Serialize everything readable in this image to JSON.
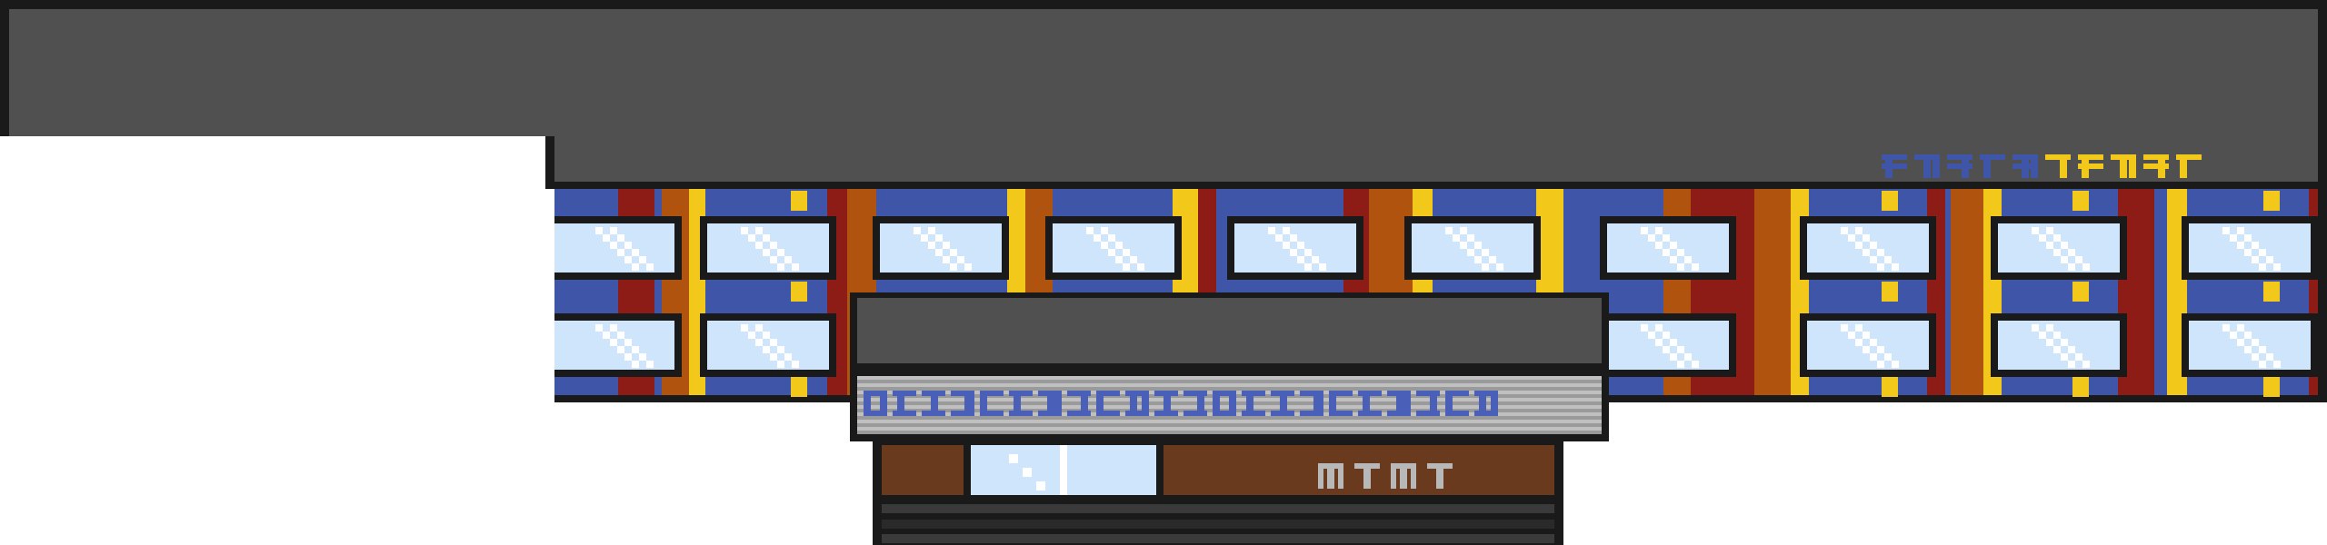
{
  "scene": {
    "name": "pixel-art-city-building",
    "colors": {
      "roof": "#505050",
      "outline": "#1a1a1a",
      "wall_blue": "#3f55a8",
      "pillar_red": "#8e1c16",
      "pillar_orange": "#b0530e",
      "pillar_yellow": "#f2c81a",
      "glass": "#cfe5fb",
      "glass_shine": "#ffffff",
      "sign_stripe_light": "#c0c0c0",
      "sign_stripe_dark": "#9a9a9a",
      "sign_text": "#4a5fb8",
      "storefront_brown": "#6a3a1e",
      "storefront_text": "#b8b8b8",
      "roof_logo_blue": "#3f55a8",
      "roof_logo_yellow": "#f2c81a",
      "step_dark": "#2a2a2a"
    },
    "roof_logo": {
      "label": "roof-logo-glyphs",
      "blue_glyphs": 5,
      "yellow_glyphs": 5
    },
    "entrance_sign": {
      "label": "pixel-glyph-banner",
      "glyphs": 22
    },
    "storefront_sign": {
      "label": "storefront-glyphs",
      "glyphs": 4
    }
  }
}
